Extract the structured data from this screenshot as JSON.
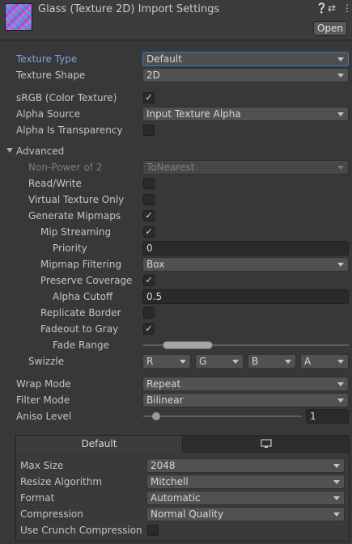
{
  "header": {
    "title": "Glass (Texture 2D) Import Settings",
    "icons": [
      "help-icon",
      "presets-icon",
      "kebab-menu-icon"
    ],
    "open_label": "Open"
  },
  "texture_type": {
    "label": "Texture Type",
    "value": "Default"
  },
  "texture_shape": {
    "label": "Texture Shape",
    "value": "2D"
  },
  "srgb": {
    "label": "sRGB (Color Texture)",
    "checked": true
  },
  "alpha_source": {
    "label": "Alpha Source",
    "value": "Input Texture Alpha"
  },
  "alpha_is_transparency": {
    "label": "Alpha Is Transparency",
    "checked": false
  },
  "advanced": {
    "label": "Advanced",
    "non_power_of_2": {
      "label": "Non-Power of 2",
      "value": "ToNearest"
    },
    "read_write": {
      "label": "Read/Write",
      "checked": false
    },
    "virtual_texture_only": {
      "label": "Virtual Texture Only",
      "checked": false
    },
    "generate_mipmaps": {
      "label": "Generate Mipmaps",
      "checked": true
    },
    "mip_streaming": {
      "label": "Mip Streaming",
      "checked": true
    },
    "priority": {
      "label": "Priority",
      "value": "0"
    },
    "mipmap_filtering": {
      "label": "Mipmap Filtering",
      "value": "Box"
    },
    "preserve_coverage": {
      "label": "Preserve Coverage",
      "checked": true
    },
    "alpha_cutoff": {
      "label": "Alpha Cutoff",
      "value": "0.5"
    },
    "replicate_border": {
      "label": "Replicate Border",
      "checked": false
    },
    "fadeout_to_gray": {
      "label": "Fadeout to Gray",
      "checked": true
    },
    "fade_range": {
      "label": "Fade Range"
    },
    "swizzle": {
      "label": "Swizzle",
      "r": "R",
      "g": "G",
      "b": "B",
      "a": "A"
    }
  },
  "wrap_mode": {
    "label": "Wrap Mode",
    "value": "Repeat"
  },
  "filter_mode": {
    "label": "Filter Mode",
    "value": "Bilinear"
  },
  "aniso_level": {
    "label": "Aniso Level",
    "value": "1"
  },
  "platform": {
    "tab_default": "Default",
    "tab_pc_icon": "monitor-icon",
    "max_size": {
      "label": "Max Size",
      "value": "2048"
    },
    "resize_algorithm": {
      "label": "Resize Algorithm",
      "value": "Mitchell"
    },
    "format": {
      "label": "Format",
      "value": "Automatic"
    },
    "compression": {
      "label": "Compression",
      "value": "Normal Quality"
    },
    "use_crunch": {
      "label": "Use Crunch Compression",
      "checked": false
    }
  },
  "colors": {
    "background": "#383838",
    "accent_label": "#7aa3e5",
    "focus_border": "#3a79bb"
  }
}
